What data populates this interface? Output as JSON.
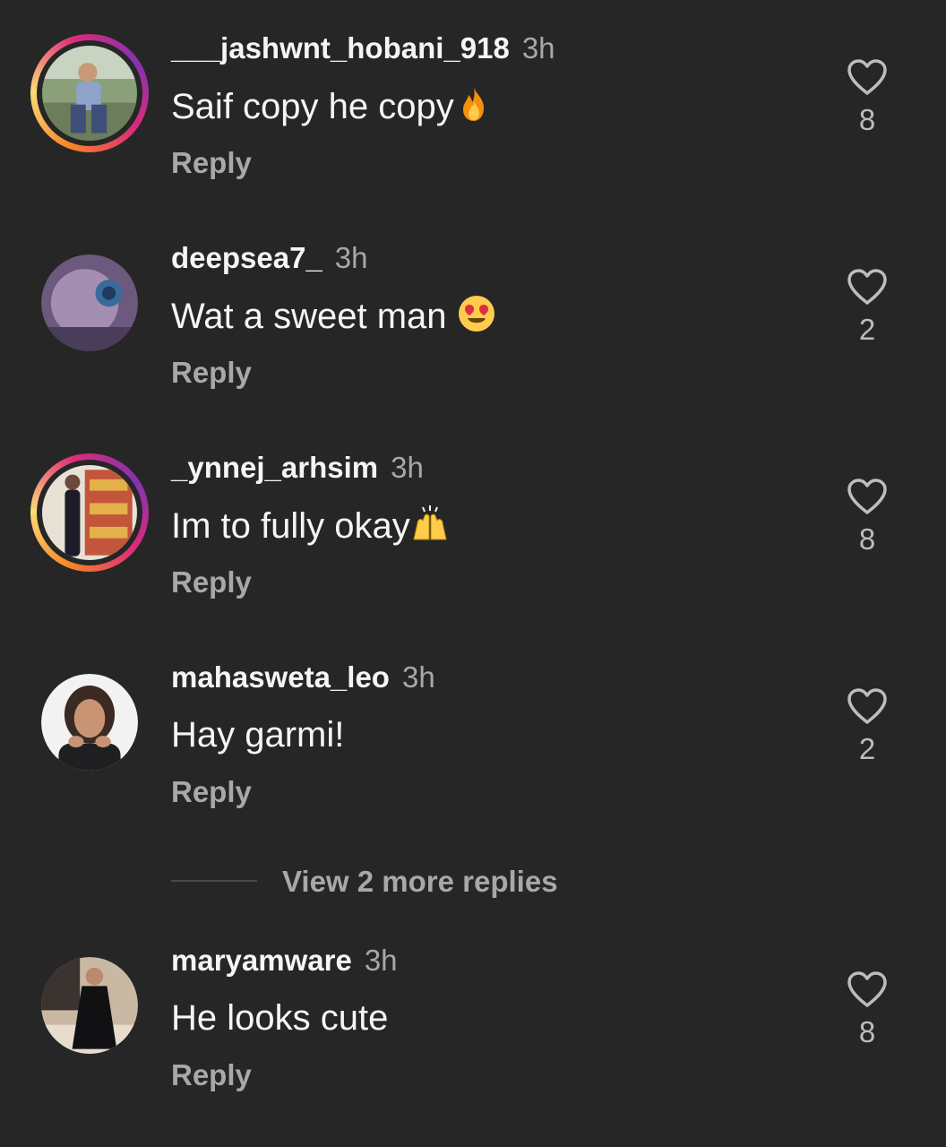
{
  "comments": [
    {
      "username": "___jashwnt_hobani_918",
      "time": "3h",
      "text": "Saif copy he copy",
      "emoji": "fire-emoji",
      "reply_label": "Reply",
      "likes": "8",
      "has_story": true
    },
    {
      "username": "deepsea7_",
      "time": "3h",
      "text": "Wat a sweet man",
      "emoji": "heart-eyes-emoji",
      "reply_label": "Reply",
      "likes": "2",
      "has_story": false
    },
    {
      "username": "_ynnej_arhsim",
      "time": "3h",
      "text": "Im to fully okay",
      "emoji": "raising-hands-emoji",
      "reply_label": "Reply",
      "likes": "8",
      "has_story": true
    },
    {
      "username": "mahasweta_leo",
      "time": "3h",
      "text": "Hay garmi!",
      "reply_label": "Reply",
      "likes": "2",
      "has_story": false
    },
    {
      "username": "maryamware",
      "time": "3h",
      "text": "He looks cute",
      "reply_label": "Reply",
      "likes": "8",
      "has_story": false
    }
  ],
  "view_more": {
    "label": "View 2 more replies"
  },
  "colors": {
    "background": "#262626",
    "primary_text": "#f5f5f5",
    "secondary_text": "#a8a8a8",
    "story_ring": [
      "#f58529",
      "#dd2a7b",
      "#8134af"
    ]
  }
}
